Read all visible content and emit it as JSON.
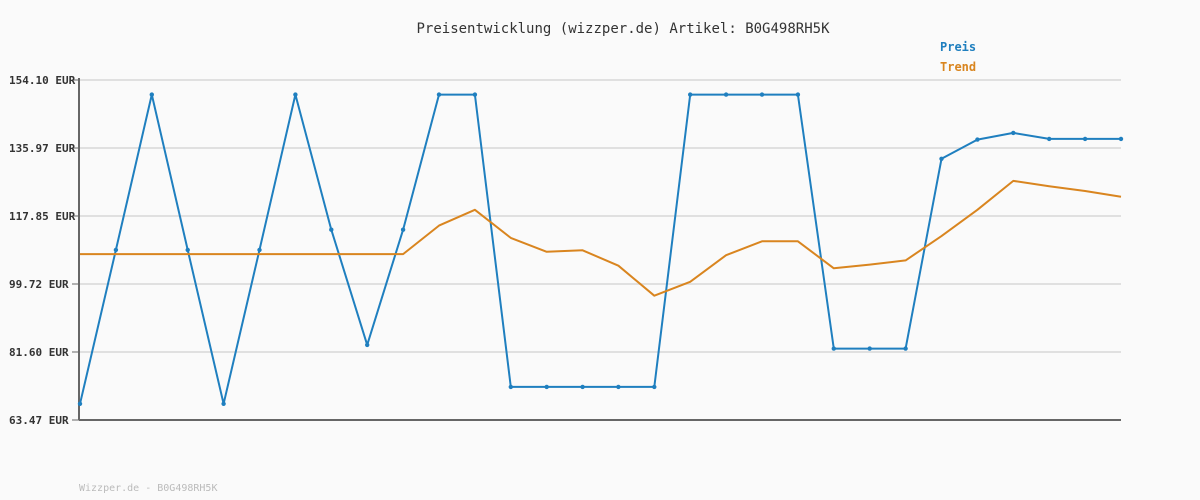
{
  "chart_data": {
    "type": "line",
    "title": "Preisentwicklung (wizzper.de) Artikel: B0G498RH5K",
    "footer": "Wizzper.de - B0G498RH5K",
    "ylim": [
      63.47,
      154.1
    ],
    "yticks": [
      "154.10 EUR",
      "135.97 EUR",
      "117.85 EUR",
      "99.72 EUR",
      "81.60 EUR",
      "63.47 EUR"
    ],
    "ytick_values": [
      154.1,
      135.97,
      117.85,
      99.72,
      81.6,
      63.47
    ],
    "grid": true,
    "legend_position": "top-right",
    "series": [
      {
        "name": "Preis",
        "color": "#1f7fbf",
        "markers": true,
        "values": [
          67.8,
          108.8,
          150.2,
          108.8,
          67.8,
          108.8,
          150.2,
          114.2,
          83.5,
          114.2,
          150.2,
          150.2,
          72.3,
          72.3,
          72.3,
          72.3,
          72.3,
          150.2,
          150.2,
          150.2,
          150.2,
          82.5,
          82.5,
          82.5,
          133.1,
          138.2,
          140.0,
          138.4,
          138.4,
          138.4
        ]
      },
      {
        "name": "Trend",
        "color": "#d9851f",
        "markers": false,
        "values": [
          107.7,
          107.7,
          107.7,
          107.7,
          107.7,
          107.7,
          107.7,
          107.7,
          107.7,
          107.7,
          115.3,
          119.5,
          112.0,
          108.3,
          108.7,
          104.6,
          96.6,
          100.3,
          107.4,
          111.1,
          111.1,
          103.9,
          104.9,
          106.0,
          112.5,
          119.5,
          127.2,
          125.8,
          124.5,
          123.0
        ]
      }
    ]
  }
}
